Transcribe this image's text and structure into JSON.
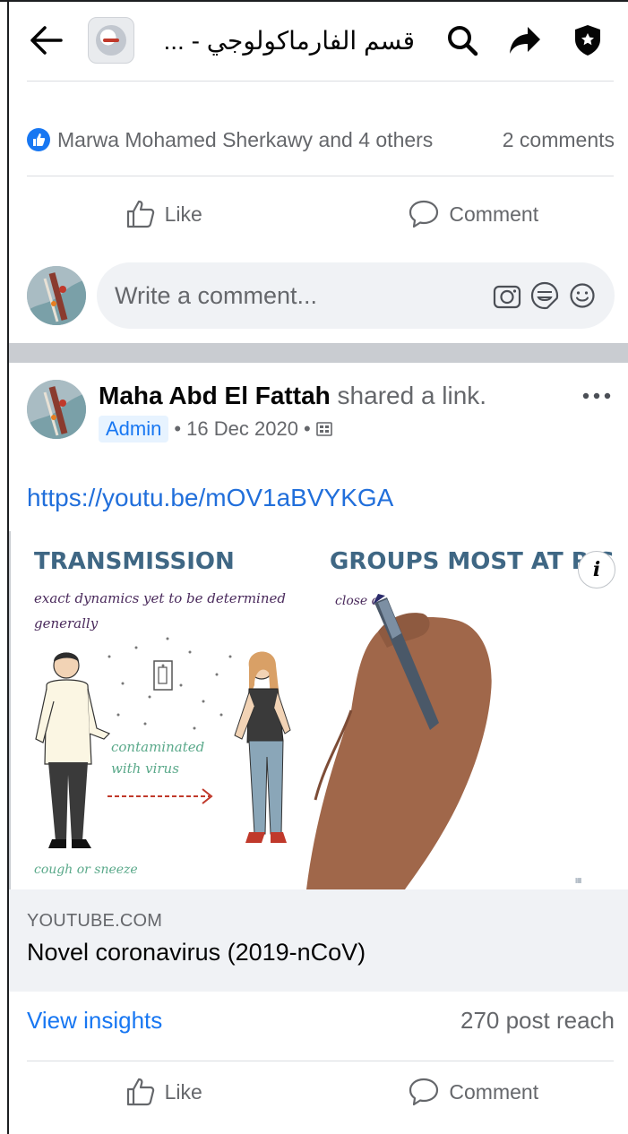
{
  "header": {
    "group_title": "قسم الفارماكولوجي - ...",
    "icons": [
      "back-arrow-icon",
      "search-icon",
      "share-arrow-icon",
      "shield-icon"
    ]
  },
  "previous_post": {
    "reactions_text": "Marwa Mohamed Sherkawy and 4 others",
    "comments_count": "2 comments",
    "like_label": "Like",
    "comment_label": "Comment"
  },
  "composer": {
    "placeholder": "Write a comment...",
    "icons": [
      "camera-icon",
      "sticker-icon",
      "emoji-icon"
    ]
  },
  "post": {
    "author": "Maha Abd El Fattah",
    "action": " shared a link.",
    "role_badge": "Admin",
    "date": "• 16 Dec 2020 •",
    "link": "https://youtu.be/mOV1aBVYKGA",
    "preview": {
      "heading_left": "TRANSMISSION",
      "heading_right": "GROUPS MOST AT RIS",
      "note1": "exact dynamics yet to be determined",
      "note2": "generally",
      "note3": "close c",
      "note4a": "contaminated",
      "note4b": "with virus",
      "note5": "cough or sneeze"
    },
    "domain": "YOUTUBE.COM",
    "title": "Novel coronavirus (2019-nCoV)",
    "view_insights": "View insights",
    "reach": "270 post reach",
    "like_label": "Like",
    "comment_label": "Comment"
  },
  "colors": {
    "accent": "#1877f2",
    "link": "#216fdb",
    "secondary_text": "#65676b",
    "separator": "#c9ccd1"
  }
}
